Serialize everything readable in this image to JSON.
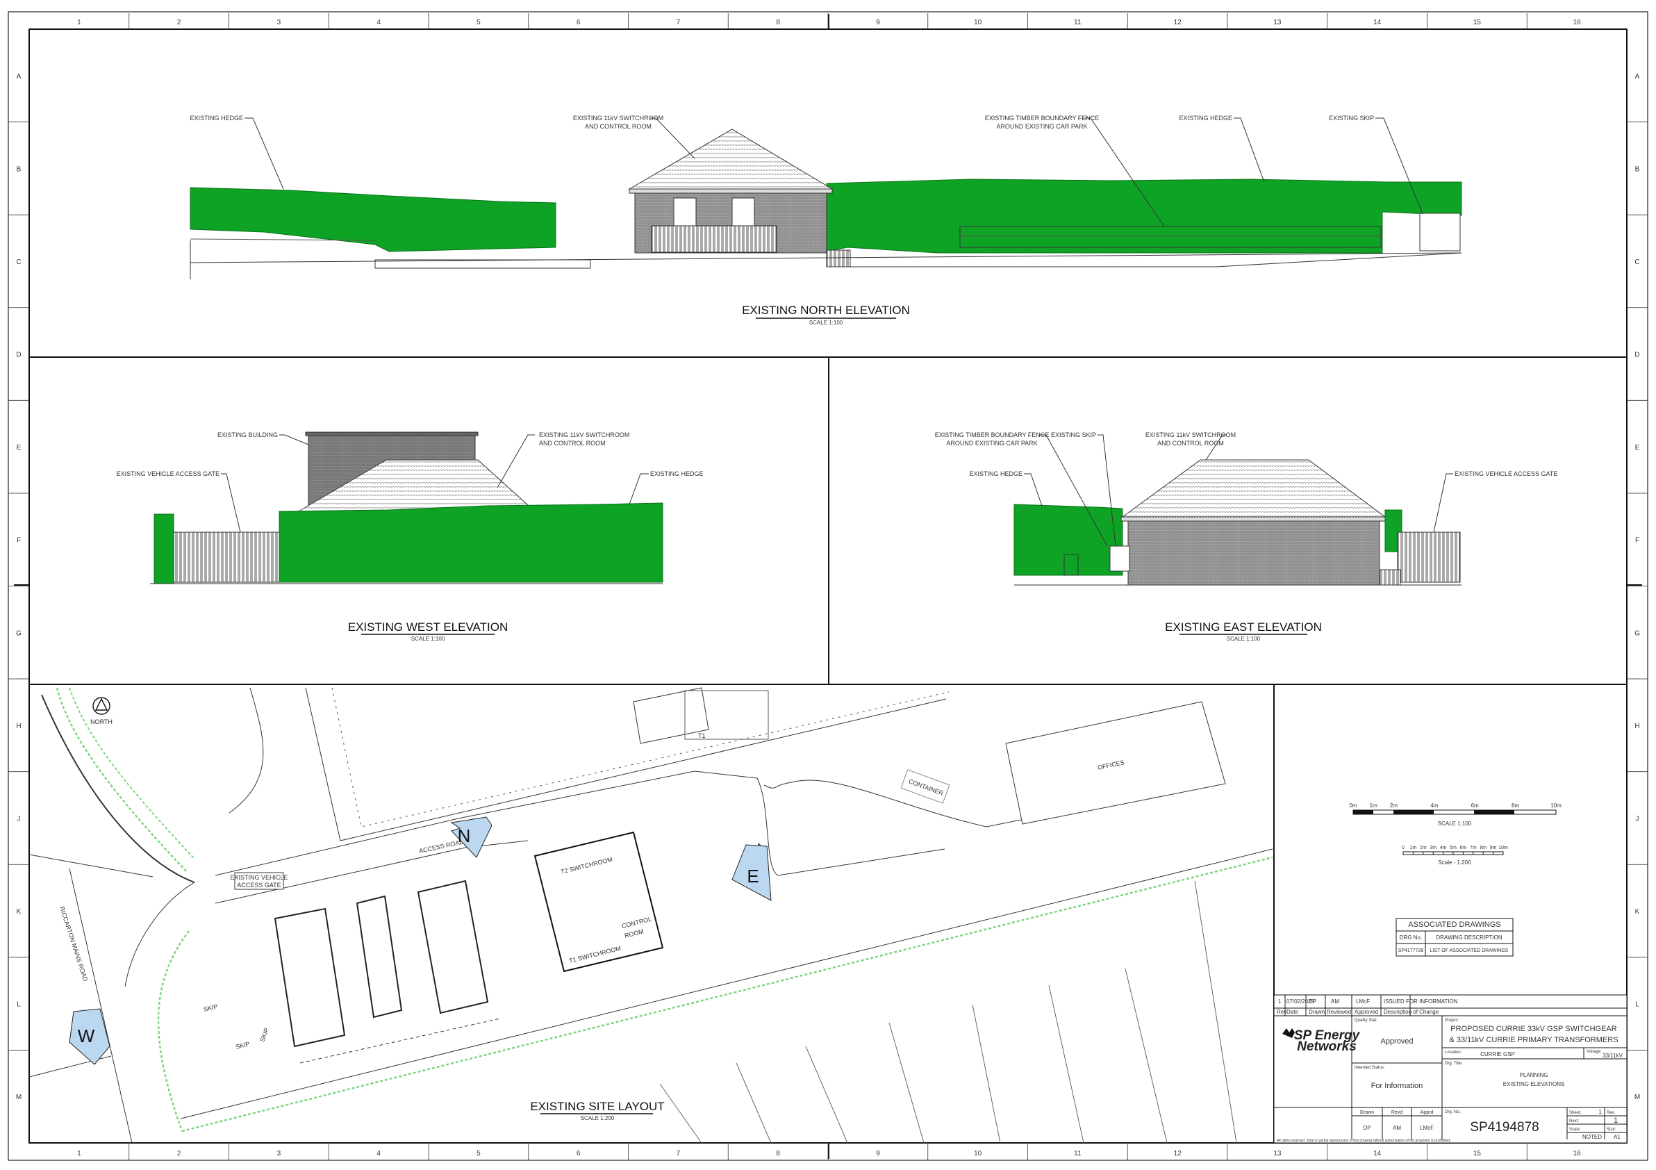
{
  "drawing": {
    "grid_columns": [
      "1",
      "2",
      "3",
      "4",
      "5",
      "6",
      "7",
      "8",
      "9",
      "10",
      "11",
      "12",
      "13",
      "14",
      "15",
      "16"
    ],
    "grid_rows": [
      "A",
      "B",
      "C",
      "D",
      "E",
      "F",
      "G",
      "H",
      "J",
      "K",
      "L",
      "M"
    ],
    "north_elevation": {
      "title": "EXISTING NORTH ELEVATION",
      "scale": "SCALE 1:100",
      "labels": {
        "hedge_left": "EXISTING HEDGE",
        "switchroom_1": "EXISTING 11kV SWITCHROOM",
        "switchroom_2": "AND CONTROL ROOM",
        "fence_1": "EXISTING TIMBER BOUNDARY FENCE",
        "fence_2": "AROUND EXISTING CAR PARK",
        "hedge_right": "EXISTING HEDGE",
        "skip": "EXISTING SKIP"
      }
    },
    "west_elevation": {
      "title": "EXISTING WEST ELEVATION",
      "scale": "SCALE 1:100",
      "labels": {
        "building": "EXISTING BUILDING",
        "switchroom_1": "EXISTING 11kV SWITCHROOM",
        "switchroom_2": "AND CONTROL ROOM",
        "gate": "EXISTING VEHICLE ACCESS GATE",
        "hedge": "EXISTING HEDGE"
      }
    },
    "east_elevation": {
      "title": "EXISTING EAST ELEVATION",
      "scale": "SCALE 1:100",
      "labels": {
        "fence_1": "EXISTING TIMBER BOUNDARY FENCE",
        "fence_2": "AROUND EXISTING CAR PARK",
        "skip": "EXISTING SKIP",
        "switchroom_1": "EXISTING 11kV SWITCHROOM",
        "switchroom_2": "AND CONTROL ROOM",
        "hedge": "EXISTING HEDGE",
        "gate": "EXISTING VEHICLE ACCESS GATE"
      }
    },
    "site_layout": {
      "title": "EXISTING SITE LAYOUT",
      "scale": "SCALE 1:200",
      "north": "NORTH",
      "t1": "T1",
      "offices": "OFFICES",
      "container": "CONTAINER",
      "access_road": "ACCESS ROAD",
      "gate_1": "EXISTING VEHICLE",
      "gate_2": "ACCESS GATE",
      "road": "RICCARTON MAINS ROAD",
      "t2_switchroom": "T2 SWITCHROOM",
      "t1_switchroom": "T1 SWITCHROOM",
      "control_1": "CONTROL",
      "control_2": "ROOM",
      "skip": "SKIP",
      "view_n": "N",
      "view_e": "E",
      "view_w": "W"
    },
    "scale_bar_100": {
      "ticks": [
        "0m",
        "1m",
        "2m",
        "4m",
        "6m",
        "8m",
        "10m"
      ],
      "label": "SCALE 1:100"
    },
    "scale_bar_200": {
      "ticks": [
        "0",
        "1m",
        "2m",
        "3m",
        "4m",
        "5m",
        "6m",
        "7m",
        "8m",
        "9m",
        "10m"
      ],
      "label": "Scale - 1:200"
    },
    "associated": {
      "title": "ASSOCIATED DRAWINGS",
      "col_no": "DRG No.",
      "col_desc": "DRAWING DESCRIPTION",
      "row_no": "SP4177726",
      "row_desc": "LIST OF ASSOCIATED DRAWINGS"
    },
    "title_block": {
      "rev_row": {
        "rev": "1",
        "date": "07/02/2025",
        "drawn": "DP",
        "reviewed": "AM",
        "approved": "LMcF",
        "desc": "ISSUED FOR INFORMATION"
      },
      "rev_headers": {
        "rev": "Rev",
        "date": "Date",
        "drawn": "Drawn",
        "reviewed": "Reviewed",
        "approved": "Approved",
        "desc": "Description of Change"
      },
      "company_1": "SP Energy",
      "company_2": "Networks",
      "quality_label": "Quality Stat:",
      "quality_value": "Approved",
      "intended_label": "Intended Status:",
      "intended_value": "For Information",
      "project_label": "Project:",
      "project_1": "PROPOSED CURRIE 33kV GSP SWITCHGEAR",
      "project_2": "& 33/11kV CURRIE PRIMARY TRANSFORMERS",
      "location_label": "Location:",
      "location_value": "CURRIE GSP",
      "voltage_label": "Voltage:",
      "voltage_value": "33/11kV",
      "dwg_title_label": "Drg. Title:",
      "dwg_title_1": "PLANNING",
      "dwg_title_2": "EXISTING ELEVATIONS",
      "drawn_label": "Drawn",
      "revd_label": "Revd",
      "apprd_label": "Apprd",
      "drawn_value": "DP",
      "revd_value": "AM",
      "apprd_value": "LMcF",
      "drg_no_label": "Drg. No.:",
      "drg_no": "SP4194878",
      "sheet_label": "Sheet:",
      "sheet_value": "1",
      "next_label": "Next:",
      "rev_label": "Rev:",
      "rev_value": "1",
      "scale_label": "Scale:",
      "scale_value": "NOTED",
      "size_label": "Size:",
      "size_value": "A1",
      "copyright": "All rights reserved. Total or partial reproduction of this drawing without authorisation of the proprietor is prohibited."
    }
  },
  "colors": {
    "hedge": "#0fa326",
    "hedge_outline": "#08701a",
    "line": "#333333",
    "brick": "#8c8c8c",
    "tree": "#7ad67a"
  }
}
